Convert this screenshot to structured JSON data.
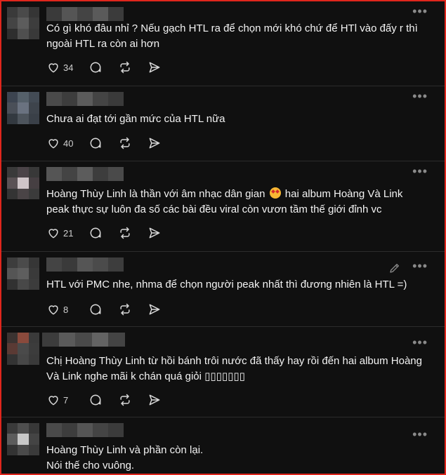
{
  "colors": {
    "background": "#101010",
    "frame_border": "#e0261c",
    "text": "#f3f3f3",
    "muted": "#8a8a8a"
  },
  "comments": [
    {
      "text": "Có gì khó đâu nhỉ ? Nếu gạch HTL ra để chọn mới khó chứ để HTl vào đấy r thì ngoài HTL ra còn ai hơn",
      "likes": "34",
      "more_label": "•••"
    },
    {
      "text": "Chưa ai đạt tới gần mức của HTL nữa",
      "likes": "40",
      "more_label": "•••"
    },
    {
      "text_before_emoji": "Hoàng Thùy Linh là thần với âm nhạc dân gian",
      "emoji": "star-struck-emoji",
      "text_after_emoji": " hai album Hoàng Và Link peak thực sự luôn đa số các bài đều viral còn vươn tầm thế giới đỉnh vc",
      "likes": "21",
      "more_label": "•••"
    },
    {
      "text": "HTL với PMC nhe, nhma để chọn người peak nhất thì đương nhiên là HTL =)",
      "likes": "8",
      "more_label": "•••",
      "edit_icon": "pencil-icon"
    },
    {
      "text": "Chị Hoàng Thùy Linh từ hồi bánh trôi nước đã thấy hay rồi đến hai album Hoàng Và Link nghe mãi k chán quá giỏi ▯▯▯▯▯▯▯",
      "likes": "7",
      "more_label": "•••"
    },
    {
      "text": "Hoàng Thùy Linh và phần còn lại.\nNói thế cho vuông.",
      "more_label": "•••"
    }
  ],
  "icons": {
    "like": "heart-icon",
    "reply": "comment-icon",
    "repost": "repost-icon",
    "share": "send-icon",
    "more": "more-icon"
  }
}
